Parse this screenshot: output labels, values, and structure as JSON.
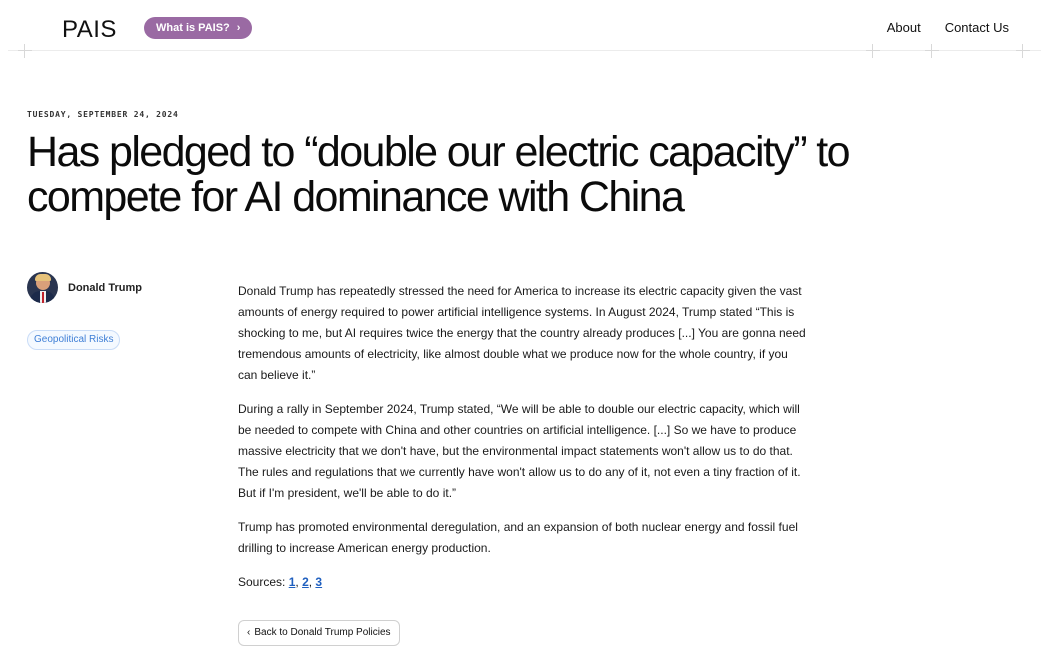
{
  "header": {
    "logo": "PAIS",
    "pill_label": "What is PAIS?",
    "pill_chevron": "›",
    "nav": [
      "About",
      "Contact Us"
    ]
  },
  "article": {
    "date": "TUESDAY, SEPTEMBER 24, 2024",
    "title": "Has pledged to “double our electric capacity” to compete for AI dominance with China",
    "author": "Donald Trump",
    "tag": "Geopolitical Risks",
    "paragraphs": [
      "Donald Trump has repeatedly stressed the need for America to increase its electric capacity given the vast amounts of energy required to power artificial intelligence systems. In August 2024, Trump stated “This is shocking to me, but AI requires twice the energy that the country already produces [...] You are gonna need tremendous amounts of electricity, like almost double what we produce now for the whole country, if you can believe it.”",
      "During a rally in September 2024, Trump stated, “We will be able to double our electric capacity, which will be needed to compete with China and other countries on artificial intelligence. [...] So we have to produce massive electricity that we don't have, but the environmental impact statements won't allow us to do that. The rules and regulations that we currently have won't allow us to do any of it, not even a tiny fraction of it. But if I'm president, we'll be able to do it.”",
      "Trump has promoted environmental deregulation, and an expansion of both nuclear energy and fossil fuel drilling to increase American energy production."
    ],
    "sources_label": "Sources:",
    "sources": [
      "1",
      "2",
      "3"
    ],
    "back_label": "Back to Donald Trump Policies",
    "back_chevron": "‹"
  },
  "colors": {
    "pill": "#9a6aa3",
    "tag_text": "#3f7fd6",
    "link": "#1f5fbf"
  },
  "icons": {
    "pill_chevron": "chevron-right-icon",
    "back_chevron": "chevron-left-icon"
  }
}
